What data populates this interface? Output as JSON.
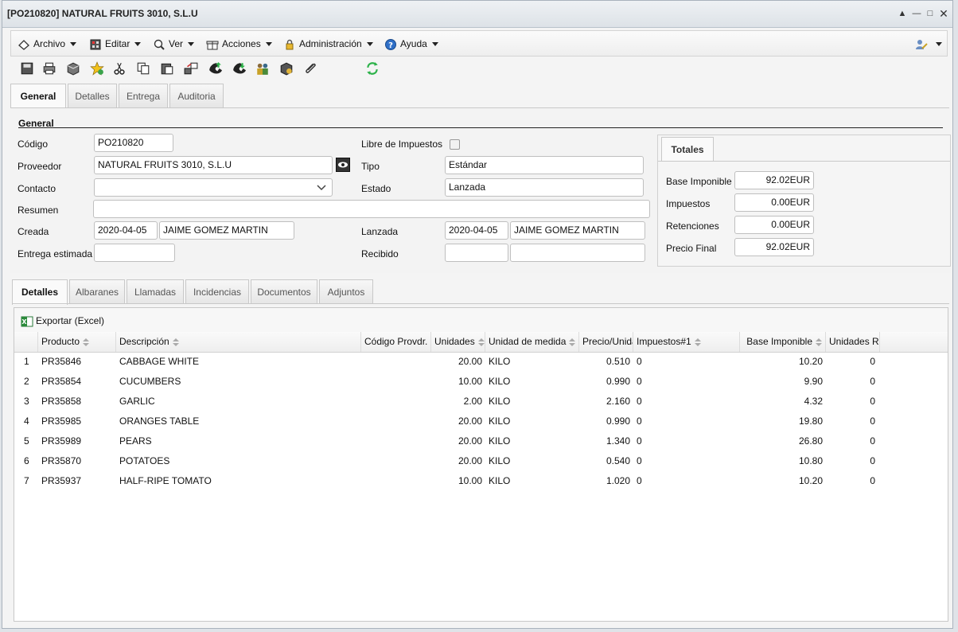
{
  "window": {
    "title": "[PO210820] NATURAL FRUITS 3010, S.L.U"
  },
  "menu": {
    "items": [
      {
        "label": "Archivo",
        "icon": "archive-icon"
      },
      {
        "label": "Editar",
        "icon": "calculator-icon"
      },
      {
        "label": "Ver",
        "icon": "magnifier-icon"
      },
      {
        "label": "Acciones",
        "icon": "gift-icon"
      },
      {
        "label": "Administración",
        "icon": "lock-icon"
      },
      {
        "label": "Ayuda",
        "icon": "help-icon"
      }
    ],
    "user_icon": "user-edit-icon"
  },
  "toolbar": {
    "icons": [
      "save-icon",
      "print-icon",
      "box-icon",
      "star-icon",
      "cut-icon",
      "copy-icon",
      "paste-icon",
      "transfer-icon",
      "phone-up-icon",
      "phone-down-icon",
      "users-icon",
      "package-icon",
      "attach-icon",
      "refresh-icon"
    ]
  },
  "main_tabs": [
    "General",
    "Detalles",
    "Entrega",
    "Auditoria"
  ],
  "general": {
    "section_title": "General",
    "codigo_label": "Código",
    "codigo_value": "PO210820",
    "proveedor_label": "Proveedor",
    "proveedor_value": "NATURAL FRUITS 3010, S.L.U",
    "contacto_label": "Contacto",
    "contacto_value": "",
    "resumen_label": "Resumen",
    "resumen_value": "",
    "creada_label": "Creada",
    "creada_date": "2020-04-05",
    "creada_user": "JAIME GOMEZ MARTIN",
    "entrega_label": "Entrega estimada",
    "entrega_value": "",
    "libre_label": "Libre de Impuestos",
    "tipo_label": "Tipo",
    "tipo_value": "Estándar",
    "estado_label": "Estado",
    "estado_value": "Lanzada",
    "lanzada_label": "Lanzada",
    "lanzada_date": "2020-04-05",
    "lanzada_user": "JAIME GOMEZ MARTIN",
    "recibido_label": "Recibido",
    "recibido_date": "",
    "recibido_user": ""
  },
  "totals": {
    "tab_label": "Totales",
    "rows": [
      {
        "label": "Base Imponible",
        "value": "92.02EUR"
      },
      {
        "label": "Impuestos",
        "value": "0.00EUR"
      },
      {
        "label": "Retenciones",
        "value": "0.00EUR"
      },
      {
        "label": "Precio Final",
        "value": "92.02EUR"
      }
    ]
  },
  "detail_tabs": [
    "Detalles",
    "Albaranes",
    "Llamadas",
    "Incidencias",
    "Documentos",
    "Adjuntos"
  ],
  "grid": {
    "export_label": "Exportar (Excel)",
    "columns": [
      "Producto",
      "Descripción",
      "Código Provdr.",
      "Unidades",
      "Unidad de medida",
      "Precio/Unidad",
      "Impuestos#1",
      "Base Imponible",
      "Unidades Re"
    ],
    "rows": [
      {
        "n": "1",
        "producto": "PR35846",
        "descripcion": "CABBAGE WHITE",
        "codigo": "",
        "unidades": "20.00",
        "medida": "KILO",
        "precio": "0.510",
        "impuestos": "0",
        "base": "10.20",
        "recibidas": "0"
      },
      {
        "n": "2",
        "producto": "PR35854",
        "descripcion": "CUCUMBERS",
        "codigo": "",
        "unidades": "10.00",
        "medida": "KILO",
        "precio": "0.990",
        "impuestos": "0",
        "base": "9.90",
        "recibidas": "0"
      },
      {
        "n": "3",
        "producto": "PR35858",
        "descripcion": "GARLIC",
        "codigo": "",
        "unidades": "2.00",
        "medida": "KILO",
        "precio": "2.160",
        "impuestos": "0",
        "base": "4.32",
        "recibidas": "0"
      },
      {
        "n": "4",
        "producto": "PR35985",
        "descripcion": "ORANGES TABLE",
        "codigo": "",
        "unidades": "20.00",
        "medida": "KILO",
        "precio": "0.990",
        "impuestos": "0",
        "base": "19.80",
        "recibidas": "0"
      },
      {
        "n": "5",
        "producto": "PR35989",
        "descripcion": "PEARS",
        "codigo": "",
        "unidades": "20.00",
        "medida": "KILO",
        "precio": "1.340",
        "impuestos": "0",
        "base": "26.80",
        "recibidas": "0"
      },
      {
        "n": "6",
        "producto": "PR35870",
        "descripcion": "POTATOES",
        "codigo": "",
        "unidades": "20.00",
        "medida": "KILO",
        "precio": "0.540",
        "impuestos": "0",
        "base": "10.80",
        "recibidas": "0"
      },
      {
        "n": "7",
        "producto": "PR35937",
        "descripcion": "HALF-RIPE TOMATO",
        "codigo": "",
        "unidades": "10.00",
        "medida": "KILO",
        "precio": "1.020",
        "impuestos": "0",
        "base": "10.20",
        "recibidas": "0"
      }
    ]
  }
}
